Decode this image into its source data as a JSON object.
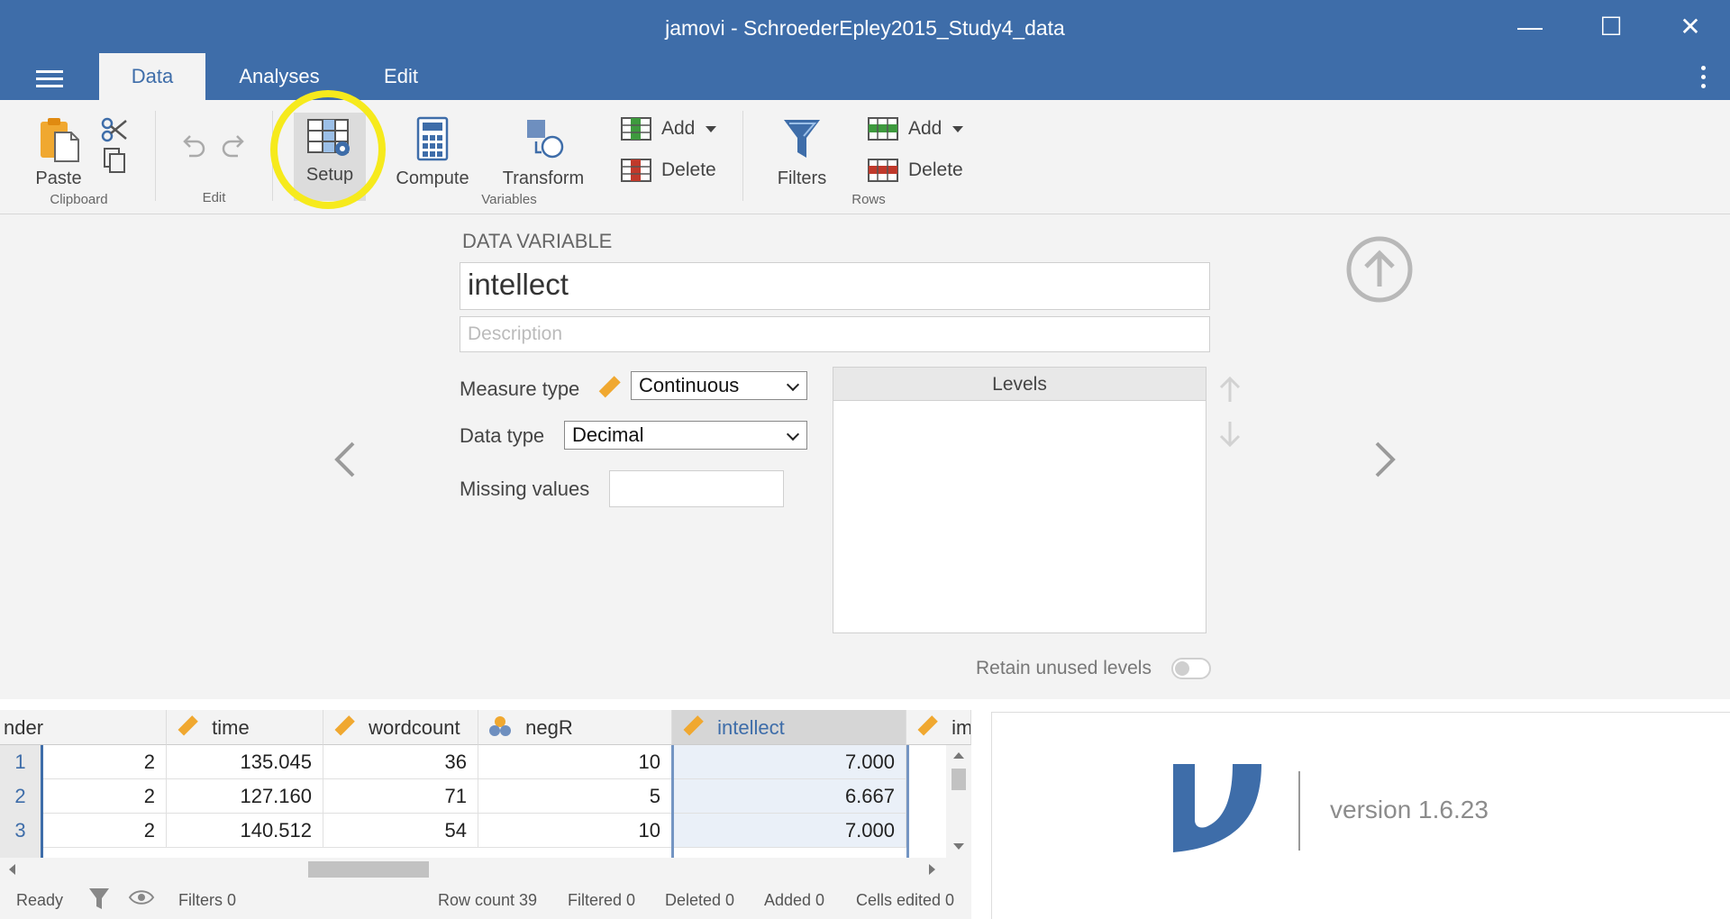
{
  "window": {
    "title": "jamovi - SchroederEpley2015_Study4_data"
  },
  "tabs": [
    "Data",
    "Analyses",
    "Edit"
  ],
  "ribbon": {
    "clipboard": {
      "paste": "Paste",
      "group": "Clipboard"
    },
    "edit": {
      "group": "Edit"
    },
    "variables": {
      "setup": "Setup",
      "compute": "Compute",
      "transform": "Transform",
      "add": "Add",
      "delete": "Delete",
      "group": "Variables"
    },
    "rows": {
      "filters": "Filters",
      "add": "Add",
      "delete": "Delete",
      "group": "Rows"
    }
  },
  "setup": {
    "heading": "DATA VARIABLE",
    "name": "intellect",
    "description_placeholder": "Description",
    "measure_type_label": "Measure type",
    "measure_type": "Continuous",
    "data_type_label": "Data type",
    "data_type": "Decimal",
    "missing_label": "Missing values",
    "levels_heading": "Levels",
    "retain_label": "Retain unused levels"
  },
  "grid": {
    "columns": [
      {
        "name": "nder",
        "icon": "none"
      },
      {
        "name": "time",
        "icon": "ruler-icon"
      },
      {
        "name": "wordcount",
        "icon": "ruler-icon"
      },
      {
        "name": "negR",
        "icon": "nominal-icon"
      },
      {
        "name": "intellect",
        "icon": "ruler-icon"
      },
      {
        "name": "im",
        "icon": "ruler-icon"
      }
    ],
    "rows": [
      {
        "n": "1",
        "cells": [
          "2",
          "135.045",
          "36",
          "10",
          "7.000"
        ]
      },
      {
        "n": "2",
        "cells": [
          "2",
          "127.160",
          "71",
          "5",
          "6.667"
        ]
      },
      {
        "n": "3",
        "cells": [
          "2",
          "140.512",
          "54",
          "10",
          "7.000"
        ]
      }
    ]
  },
  "status": {
    "ready": "Ready",
    "filters": "Filters 0",
    "row_count": "Row count 39",
    "filtered": "Filtered 0",
    "deleted": "Deleted 0",
    "added": "Added 0",
    "cells_edited": "Cells edited 0"
  },
  "about": {
    "version": "version 1.6.23"
  },
  "colors": {
    "brand": "#3E6DA9",
    "highlight": "#F6EA1C"
  }
}
